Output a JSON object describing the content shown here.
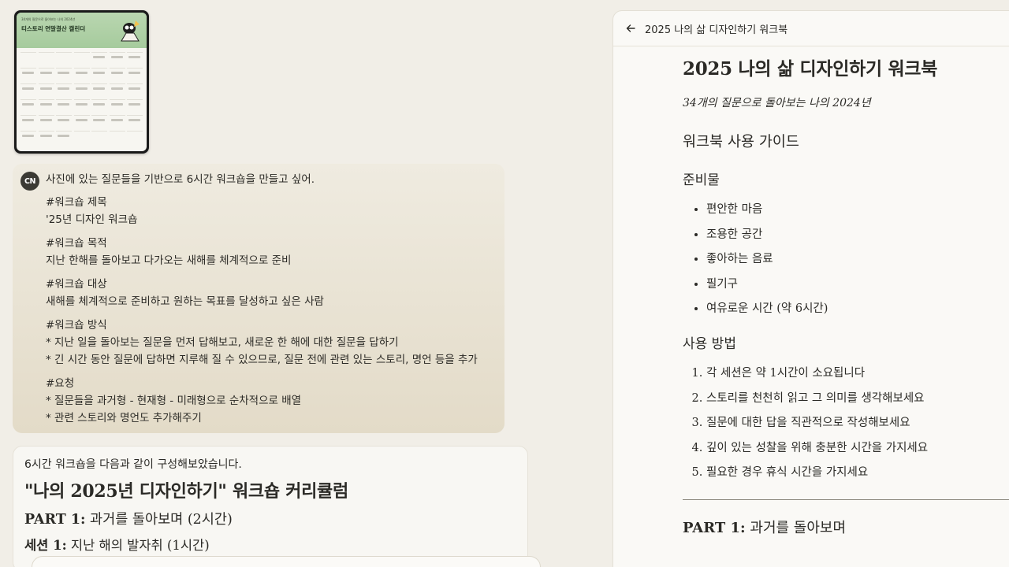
{
  "thumbnail": {
    "subtitle": "34개의 질문으로 돌아보는 나의 2024년",
    "title": "티스토리 연말결산 캘린더"
  },
  "user_message": {
    "avatar_initials": "CN",
    "intro": "사진에 있는 질문들을 기반으로 6시간 워크숍을 만들고 싶어.",
    "blocks": [
      {
        "heading": "#워크숍 제목",
        "lines": [
          "'25년 디자인 워크숍"
        ]
      },
      {
        "heading": "#워크숍 목적",
        "lines": [
          "지난 한해를 돌아보고 다가오는 새해를 체계적으로 준비"
        ]
      },
      {
        "heading": "#워크숍 대상",
        "lines": [
          "새해를 체계적으로 준비하고 원하는 목표를 달성하고 싶은 사람"
        ]
      },
      {
        "heading": "#워크숍 방식",
        "lines": [
          "* 지난 일을 돌아보는 질문을 먼저 답해보고, 새로운 한 해에 대한 질문을 답하기",
          "* 긴 시간 동안 질문에 답하면 지루해 질 수 있으므로, 질문 전에 관련 있는 스토리, 명언 등을 추가"
        ]
      },
      {
        "heading": "#요청",
        "lines": [
          "* 질문들을 과거형 - 현재형 - 미래형으로 순차적으로 배열",
          "* 관련 스토리와 명언도 추가해주기"
        ]
      }
    ]
  },
  "assistant_message": {
    "lead": "6시간 워크숍을 다음과 같이 구성해보았습니다.",
    "heading": "\"나의 2025년 디자인하기\" 워크숍 커리큘럼",
    "part_prefix": "PART 1:",
    "part_text": " 과거를 돌아보며 (2시간)",
    "session_prefix": "세션 1:",
    "session_text": " 지난 해의 발자취 (1시간)"
  },
  "artifact": {
    "header_title": "2025 나의 삶 디자인하기 워크북",
    "doc_title": "2025 나의 삶 디자인하기 워크북",
    "subtitle": "34개의 질문으로 돌아보는 나의 2024년",
    "guide_heading": "워크북 사용 가이드",
    "materials_heading": "준비물",
    "materials": [
      "편안한 마음",
      "조용한 공간",
      "좋아하는 음료",
      "필기구",
      "여유로운 시간 (약 6시간)"
    ],
    "method_heading": "사용 방법",
    "methods": [
      "각 세션은 약 1시간이 소요됩니다",
      "스토리를 천천히 읽고 그 의미를 생각해보세요",
      "질문에 대한 답을 직관적으로 작성해보세요",
      "깊이 있는 성찰을 위해 충분한 시간을 가지세요",
      "필요한 경우 휴식 시간을 가지세요"
    ],
    "part_prefix": "PART 1:",
    "part_text": " 과거를 돌아보며"
  }
}
